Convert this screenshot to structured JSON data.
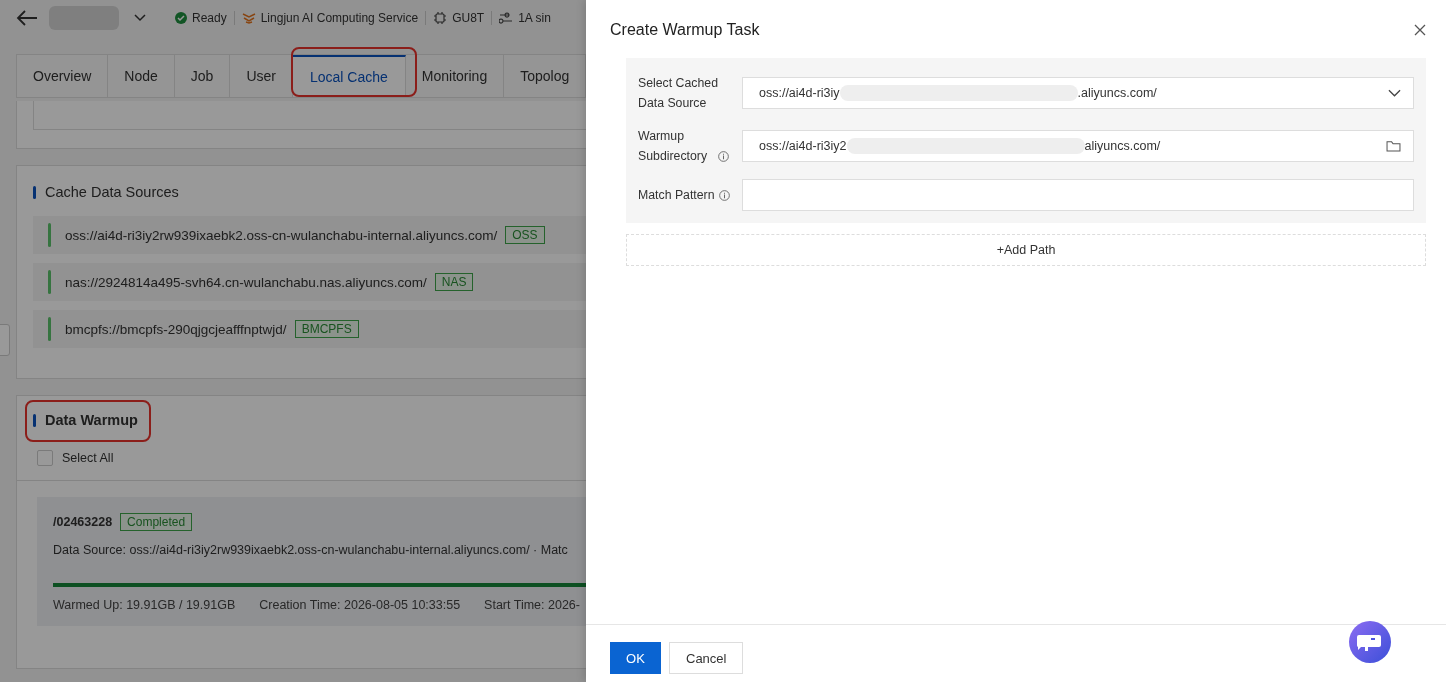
{
  "header": {
    "status": "Ready",
    "service": "Lingjun AI Computing Service",
    "gpu": "GU8T",
    "spec": "1A sin"
  },
  "tabs": [
    {
      "label": "Overview",
      "selected": false
    },
    {
      "label": "Node",
      "selected": false
    },
    {
      "label": "Job",
      "selected": false
    },
    {
      "label": "User",
      "selected": false
    },
    {
      "label": "Local Cache",
      "selected": true
    },
    {
      "label": "Monitoring",
      "selected": false
    },
    {
      "label": "Topolog",
      "selected": false
    }
  ],
  "cache_sources": {
    "title": "Cache Data Sources",
    "items": [
      {
        "url": "oss://ai4d-ri3iy2rw939ixaebk2.oss-cn-wulanchabu-internal.aliyuncs.com/",
        "tag": "OSS"
      },
      {
        "url": "nas://2924814a495-svh64.cn-wulanchabu.nas.aliyuncs.com/",
        "tag": "NAS"
      },
      {
        "url": "bmcpfs://bmcpfs-290qjgcjeafffnptwjd/",
        "tag": "BMCPFS"
      }
    ]
  },
  "data_warmup": {
    "title": "Data Warmup",
    "select_all": {
      "label": "Select All",
      "checked": false
    },
    "tasks": [
      {
        "path": "/02463228",
        "status": "Completed",
        "source": "Data Source: oss://ai4d-ri3iy2rw939ixaebk2.oss-cn-wulanchabu-internal.aliyuncs.com/ · Matc",
        "level": 1.0,
        "warmed": "Warmed Up: 19.91GB / 19.91GB",
        "created": "Creation Time: 2026-08-05 10:33:55",
        "started": "Start Time: 2026-"
      }
    ]
  },
  "drawer": {
    "title": "Create Warmup Task",
    "fields": [
      {
        "kind": "select",
        "label": "Select Cached Data Source",
        "info": false,
        "value_start": "oss://ai4d-ri3iy",
        "value_end": ".aliyuncs.com/"
      },
      {
        "kind": "folder",
        "label": "Warmup Subdirectory",
        "info": true,
        "value_start": "oss://ai4d-ri3iy2",
        "value_end": "aliyuncs.com/"
      },
      {
        "kind": "text",
        "label": "Match Pattern",
        "info": true
      }
    ],
    "add_path": "+Add Path",
    "buttons": [
      {
        "label": "OK",
        "kind": "primary"
      },
      {
        "label": "Cancel",
        "kind": "default"
      }
    ]
  }
}
